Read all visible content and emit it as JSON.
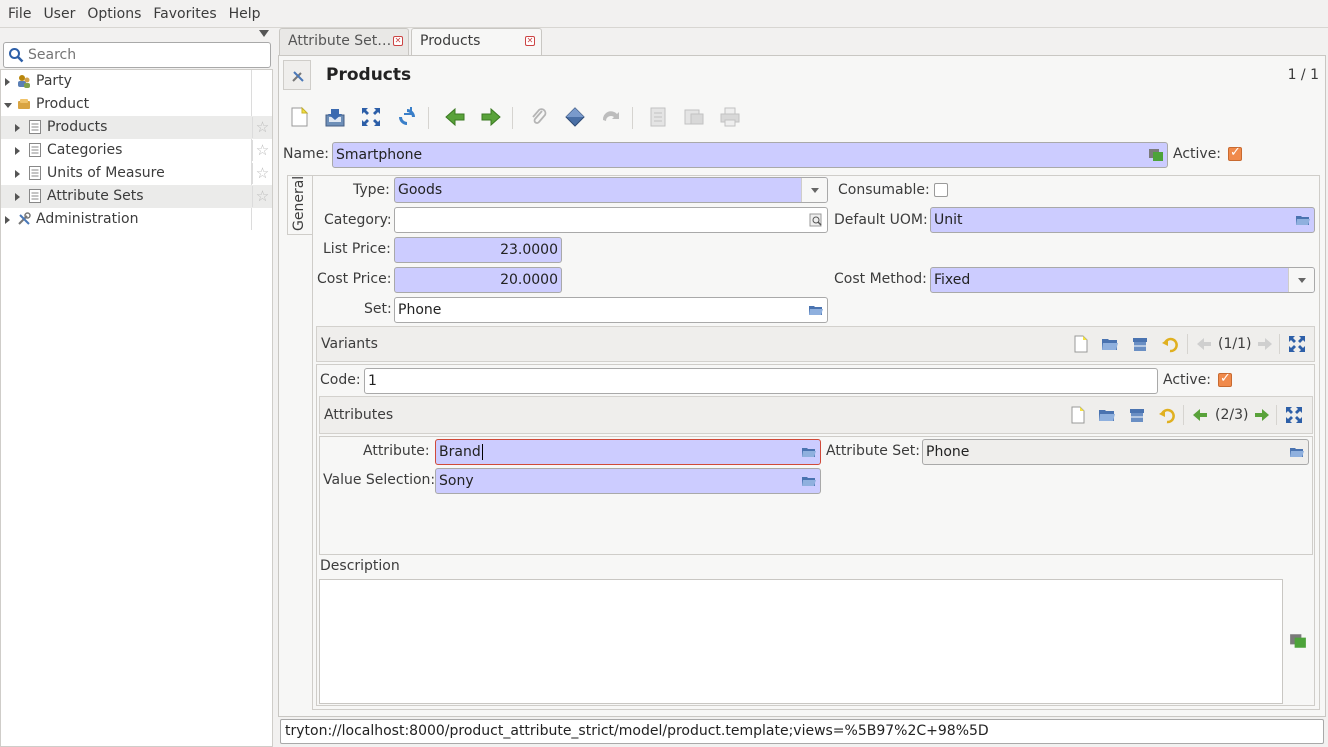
{
  "menubar": {
    "items": [
      "File",
      "User",
      "Options",
      "Favorites",
      "Help"
    ]
  },
  "sidebar": {
    "search_placeholder": "Search",
    "tree": [
      {
        "label": "Party",
        "level": 0,
        "expanded": false,
        "icon": "party-icon"
      },
      {
        "label": "Product",
        "level": 0,
        "expanded": true,
        "icon": "product-folder-icon"
      },
      {
        "label": "Products",
        "level": 1,
        "expanded": false,
        "icon": "list-icon"
      },
      {
        "label": "Categories",
        "level": 1,
        "expanded": false,
        "icon": "list-icon"
      },
      {
        "label": "Units of Measure",
        "level": 1,
        "expanded": false,
        "icon": "list-icon"
      },
      {
        "label": "Attribute Sets",
        "level": 1,
        "expanded": false,
        "icon": "list-icon"
      },
      {
        "label": "Administration",
        "level": 0,
        "expanded": false,
        "icon": "tools-icon"
      }
    ]
  },
  "tabs": [
    {
      "label": "Attribute Set…",
      "active": false
    },
    {
      "label": "Products",
      "active": true
    }
  ],
  "form": {
    "title": "Products",
    "record_counter": "1 / 1",
    "name_label": "Name:",
    "name_value": "Smartphone",
    "active_label": "Active:",
    "active_checked": true,
    "page_tab": "General",
    "type_label": "Type:",
    "type_value": "Goods",
    "consumable_label": "Consumable:",
    "consumable_checked": false,
    "category_label": "Category:",
    "category_value": "",
    "default_uom_label": "Default UOM:",
    "default_uom_value": "Unit",
    "list_price_label": "List Price:",
    "list_price_value": "23.0000",
    "cost_price_label": "Cost Price:",
    "cost_price_value": "20.0000",
    "cost_method_label": "Cost Method:",
    "cost_method_value": "Fixed",
    "set_label": "Set:",
    "set_value": "Phone",
    "variants": {
      "title": "Variants",
      "counter": "(1/1)",
      "code_label": "Code:",
      "code_value": "1",
      "active_label": "Active:",
      "active_checked": true
    },
    "attributes": {
      "title": "Attributes",
      "counter": "(2/3)",
      "attribute_label": "Attribute:",
      "attribute_value": "Brand",
      "attribute_set_label": "Attribute Set:",
      "attribute_set_value": "Phone",
      "value_selection_label": "Value Selection:",
      "value_selection_value": "Sony"
    },
    "description_label": "Description",
    "description_value": ""
  },
  "statusbar": {
    "url": "tryton://localhost:8000/product_attribute_strict/model/product.template;views=%5B97%2C+98%5D"
  },
  "colors": {
    "required_field": "#ccccff",
    "checkbox_checked": "#f08a4b",
    "error_border": "#d04a3a"
  }
}
